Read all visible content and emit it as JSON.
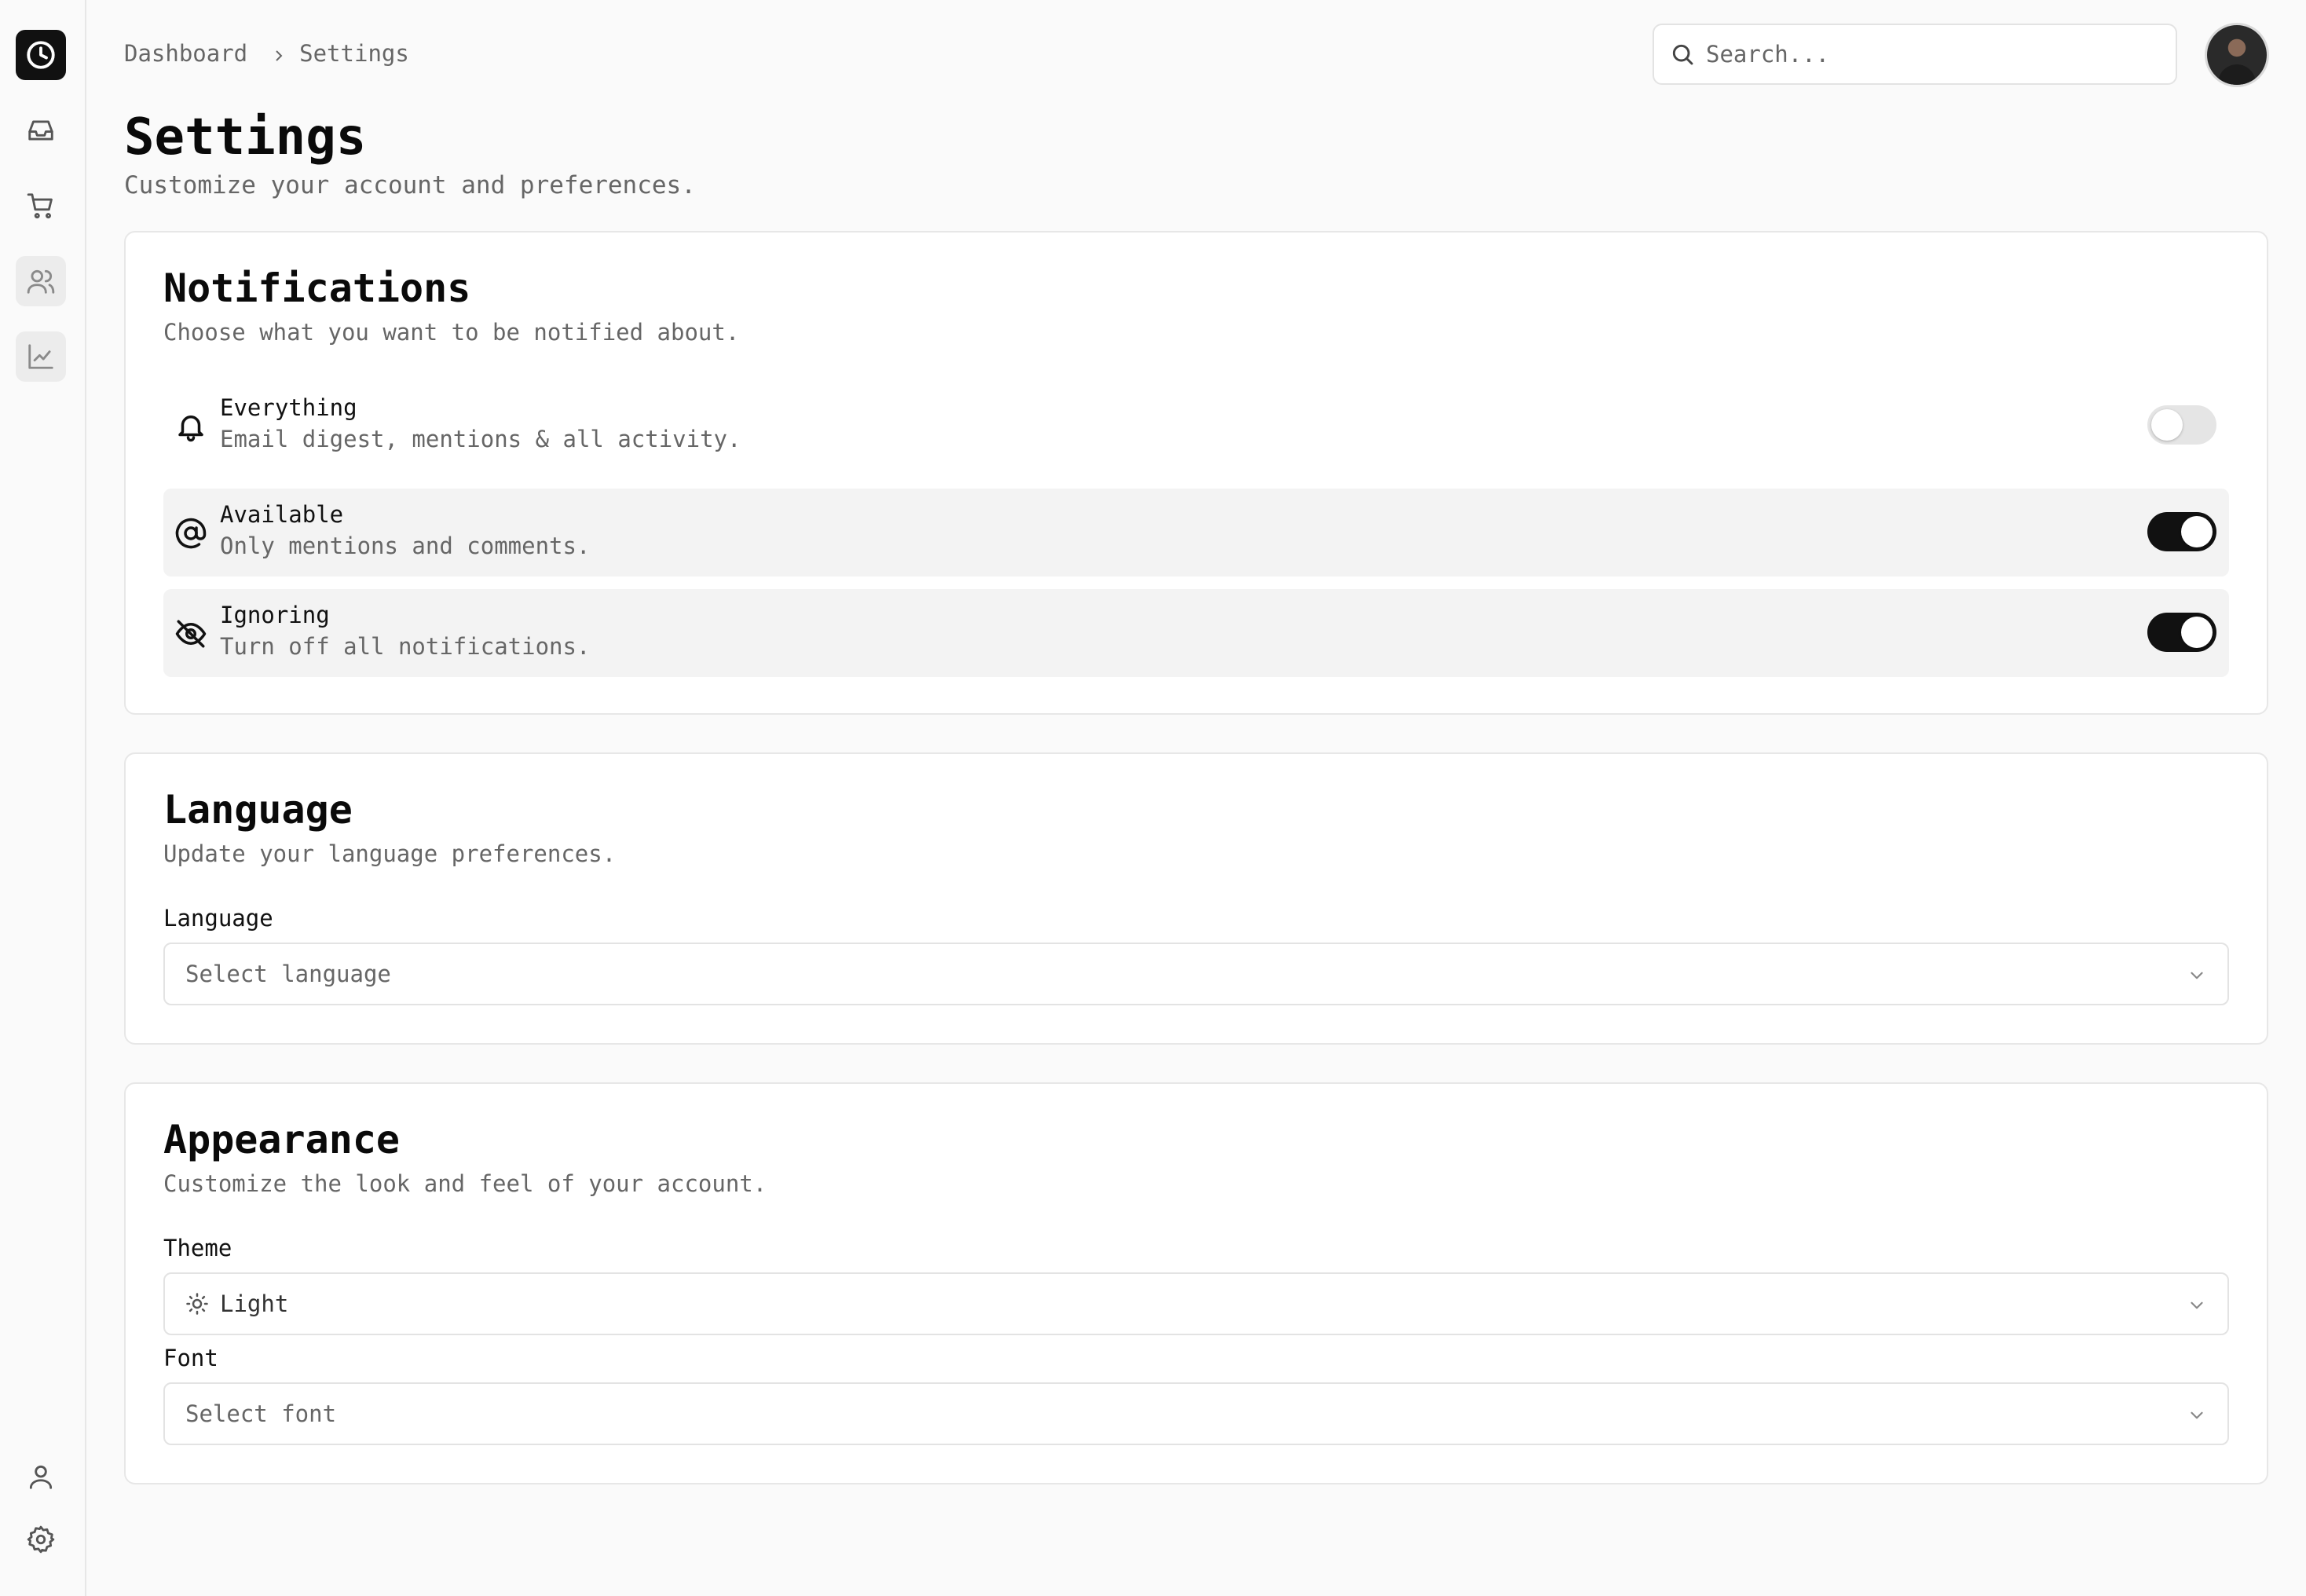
{
  "breadcrumb": {
    "items": [
      "Dashboard",
      "Settings"
    ]
  },
  "search": {
    "placeholder": "Search..."
  },
  "sidebar": {
    "top_icons": [
      "clock-logo-icon",
      "inbox-icon",
      "cart-icon",
      "users-icon",
      "chart-line-icon"
    ],
    "bottom_icons": [
      "user-icon",
      "gear-icon"
    ],
    "active": "users-icon"
  },
  "page": {
    "title": "Settings",
    "subtitle": "Customize your account and preferences."
  },
  "notifications": {
    "title": "Notifications",
    "description": "Choose what you want to be notified about.",
    "options": [
      {
        "icon": "bell-icon",
        "title": "Everything",
        "description": "Email digest, mentions & all activity.",
        "enabled": false
      },
      {
        "icon": "at-sign-icon",
        "title": "Available",
        "description": "Only mentions and comments.",
        "enabled": true
      },
      {
        "icon": "eye-off-icon",
        "title": "Ignoring",
        "description": "Turn off all notifications.",
        "enabled": true
      }
    ]
  },
  "language": {
    "title": "Language",
    "description": "Update your language preferences.",
    "field_label": "Language",
    "placeholder": "Select language"
  },
  "appearance": {
    "title": "Appearance",
    "description": "Customize the look and feel of your account.",
    "theme_label": "Theme",
    "theme_value": "Light",
    "font_label": "Font",
    "font_placeholder": "Select font"
  },
  "colors": {
    "accent": "#111111",
    "background": "#fafafa",
    "muted_text": "#666666"
  }
}
